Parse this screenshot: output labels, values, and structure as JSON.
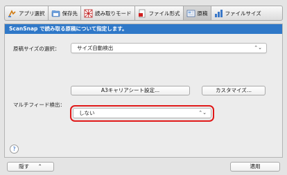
{
  "tabs": [
    {
      "label": "アプリ選択",
      "icon": "app-select-icon",
      "active": false
    },
    {
      "label": "保存先",
      "icon": "folder-icon",
      "active": false
    },
    {
      "label": "読み取りモード",
      "icon": "scan-mode-icon",
      "active": false
    },
    {
      "label": "ファイル形式",
      "icon": "file-format-icon",
      "active": false
    },
    {
      "label": "原稿",
      "icon": "document-icon",
      "active": true
    },
    {
      "label": "ファイルサイズ",
      "icon": "file-size-icon",
      "active": false
    }
  ],
  "panel": {
    "header": "ScanSnap で読み取る原稿について指定します。",
    "paper_size_label": "原稿サイズの選択：",
    "paper_size_value": "サイズ自動検出",
    "carrier_button": "A3キャリアシート設定...",
    "customize_button": "カスタマイズ...",
    "multifeed_label": "マルチフィード検出：",
    "multifeed_value": "しない",
    "help_glyph": "?"
  },
  "footer": {
    "hide_button": "隠す",
    "hide_chevron": "⌃",
    "apply_button": "適用"
  },
  "colors": {
    "header_blue": "#2f78c8",
    "highlight_red": "#e01818"
  }
}
